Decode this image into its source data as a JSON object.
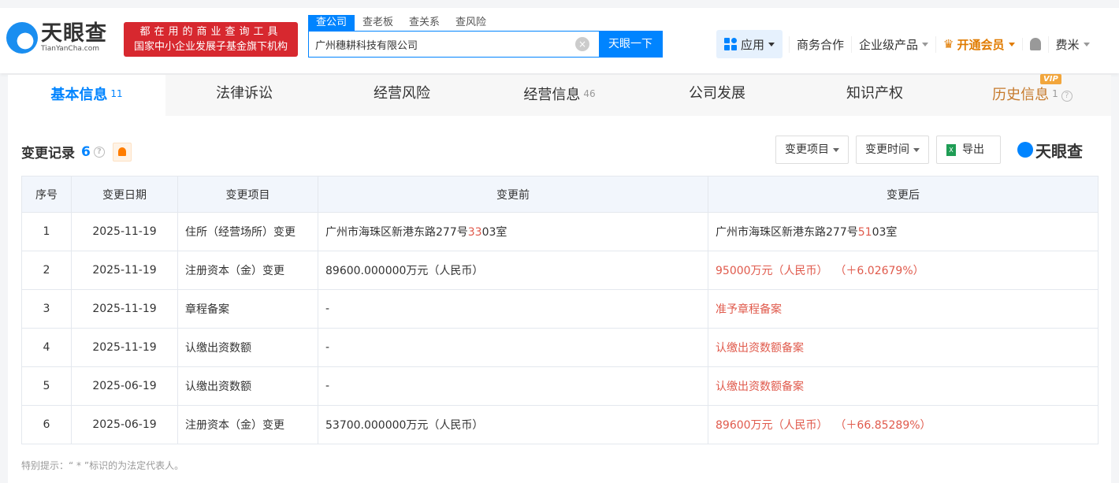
{
  "header": {
    "logo_cn": "天眼查",
    "logo_en": "TianYanCha.com",
    "slogan_line1": "都在用的商业查询工具",
    "slogan_line2": "国家中小企业发展子基金旗下机构",
    "search_tabs": [
      "查公司",
      "查老板",
      "查关系",
      "查风险"
    ],
    "search_value": "广州穗耕科技有限公司",
    "search_button": "天眼一下",
    "nav": {
      "app": "应用",
      "business": "商务合作",
      "enterprise": "企业级产品",
      "vip": "开通会员",
      "user": "费米"
    }
  },
  "tabs": [
    {
      "label": "基本信息",
      "count": "11"
    },
    {
      "label": "法律诉讼"
    },
    {
      "label": "经营风险"
    },
    {
      "label": "经营信息",
      "count": "46"
    },
    {
      "label": "公司发展"
    },
    {
      "label": "知识产权"
    },
    {
      "label": "历史信息",
      "count": "1",
      "badge": "VIP"
    }
  ],
  "section": {
    "title": "变更记录",
    "count": "6",
    "filter_item": "变更项目",
    "filter_time": "变更时间",
    "export": "导出",
    "brand": "天眼查"
  },
  "table": {
    "headers": [
      "序号",
      "变更日期",
      "变更项目",
      "变更前",
      "变更后"
    ],
    "rows": [
      {
        "no": "1",
        "date": "2025-11-19",
        "item": "住所（经营场所）变更",
        "before_a": "广州市海珠区新港东路277号",
        "before_h": "33",
        "before_b": "03室",
        "after_a": "广州市海珠区新港东路277号",
        "after_h": "51",
        "after_b": "03室"
      },
      {
        "no": "2",
        "date": "2025-11-19",
        "item": "注册资本（金）变更",
        "before": "89600.000000万元（人民币）",
        "after": "95000万元（人民币）  （＋6.02679%）"
      },
      {
        "no": "3",
        "date": "2025-11-19",
        "item": "章程备案",
        "before": "-",
        "after": "准予章程备案"
      },
      {
        "no": "4",
        "date": "2025-11-19",
        "item": "认缴出资数额",
        "before": "-",
        "after": "认缴出资数额备案"
      },
      {
        "no": "5",
        "date": "2025-06-19",
        "item": "认缴出资数额",
        "before": "-",
        "after": "认缴出资数额备案"
      },
      {
        "no": "6",
        "date": "2025-06-19",
        "item": "注册资本（金）变更",
        "before": "53700.000000万元（人民币）",
        "after": "89600万元（人民币）  （＋66.85289%）"
      }
    ]
  },
  "note": "特别提示：“ * ”标识的为法定代表人。"
}
